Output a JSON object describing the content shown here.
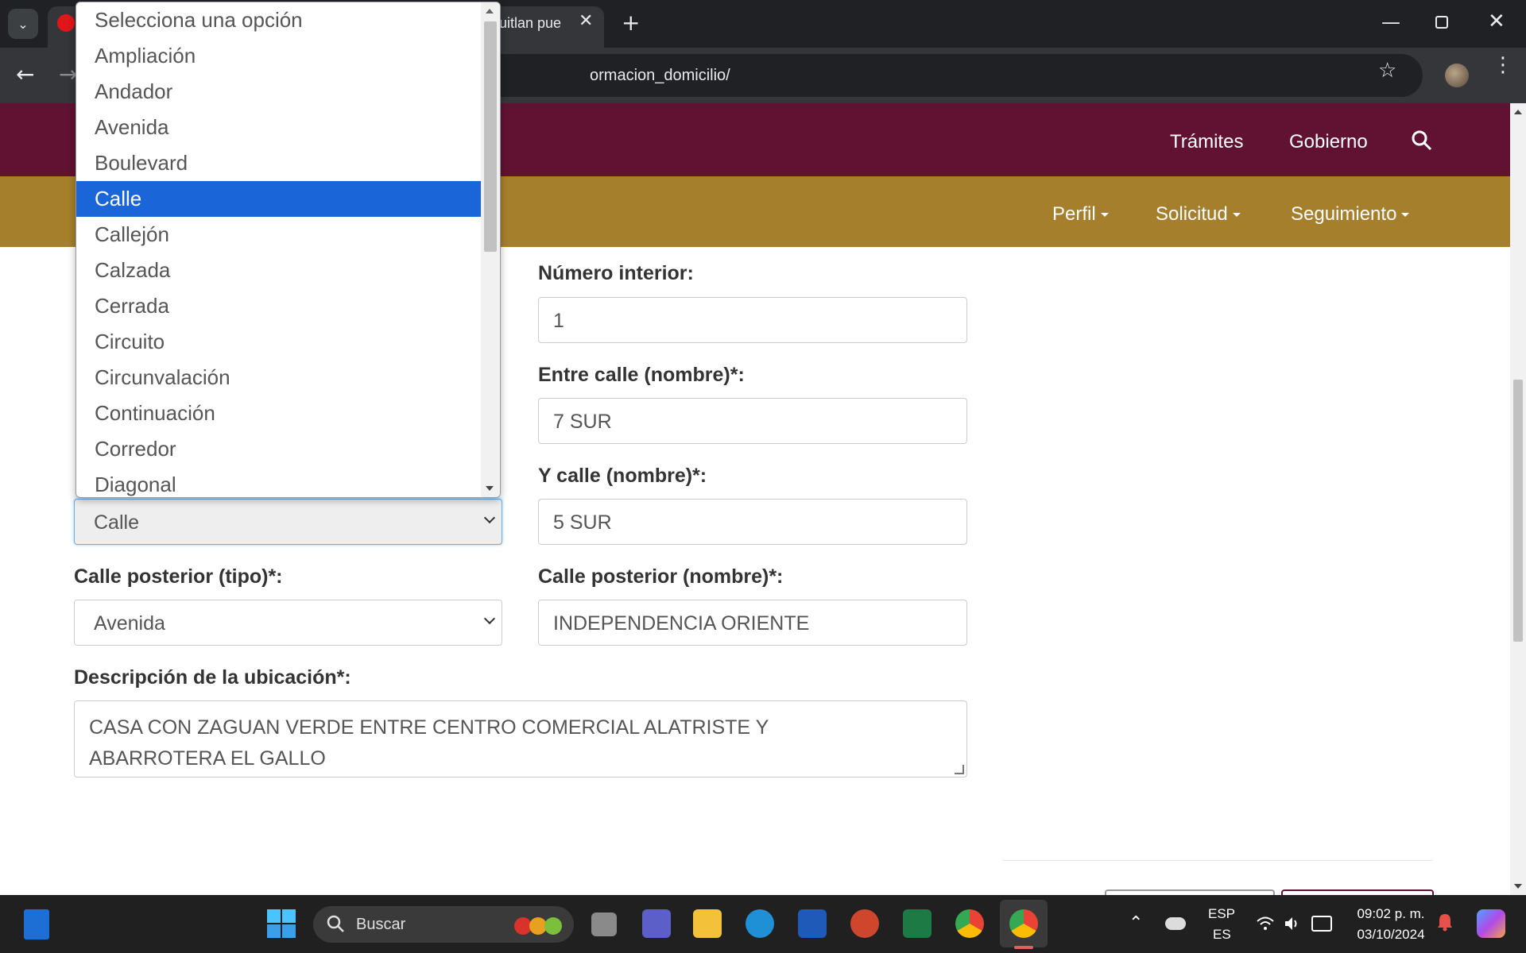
{
  "browser": {
    "tab_title": "uitlan pue",
    "tab_close": "✕",
    "new_tab": "+",
    "url": "ormacion_domicilio/",
    "win_min": "—",
    "win_close": "✕"
  },
  "header": {
    "nav_links": [
      "Trámites",
      "Gobierno"
    ],
    "sub_links": [
      "Perfil",
      "Solicitud",
      "Seguimiento"
    ]
  },
  "form": {
    "numero_interior": {
      "label": "Número interior:",
      "value": "1"
    },
    "entre_calle_nombre": {
      "label": "Entre calle (nombre)*:",
      "value": "7 SUR"
    },
    "y_calle_nombre": {
      "label": "Y calle (nombre)*:",
      "value": "5 SUR"
    },
    "y_calle_tipo": {
      "value": "Calle"
    },
    "calle_posterior_tipo": {
      "label": "Calle posterior (tipo)*:",
      "value": "Avenida"
    },
    "calle_posterior_nombre": {
      "label": "Calle posterior (nombre)*:",
      "value": "INDEPENDENCIA ORIENTE"
    },
    "descripcion": {
      "label": "Descripción de la ubicación*:",
      "line1": "CASA CON ZAGUAN VERDE ENTRE CENTRO COMERCIAL ALATRISTE Y",
      "line2": "ABARROTERA EL GALLO"
    }
  },
  "dropdown": {
    "options": [
      "Selecciona una opción",
      "Ampliación",
      "Andador",
      "Avenida",
      "Boulevard",
      "Calle",
      "Callejón",
      "Calzada",
      "Cerrada",
      "Circuito",
      "Circunvalación",
      "Continuación",
      "Corredor",
      "Diagonal"
    ],
    "selected_index": 5
  },
  "taskbar": {
    "search_placeholder": "Buscar",
    "lang_top": "ESP",
    "lang_bottom": "ES",
    "time": "09:02 p. m.",
    "date": "03/10/2024"
  },
  "colors": {
    "primary_nav": "#611232",
    "secondary_nav": "#a57f2c",
    "selected_option": "#1a66d9"
  }
}
